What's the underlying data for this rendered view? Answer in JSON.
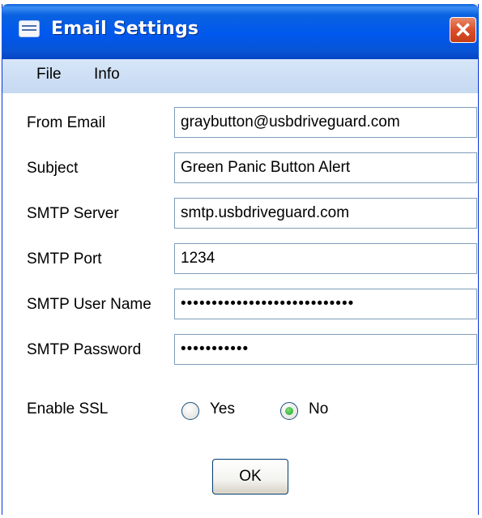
{
  "window": {
    "title": "Email Settings"
  },
  "menu": {
    "items": [
      "File",
      "Info"
    ]
  },
  "form": {
    "from_email": {
      "label": "From Email",
      "value": "graybutton@usbdriveguard.com"
    },
    "subject": {
      "label": "Subject",
      "value": "Green Panic Button Alert"
    },
    "smtp_server": {
      "label": "SMTP Server",
      "value": "smtp.usbdriveguard.com"
    },
    "smtp_port": {
      "label": "SMTP Port",
      "value": "1234"
    },
    "smtp_user": {
      "label": "SMTP User Name",
      "value": "••••••••••••••••••••••••••••"
    },
    "smtp_password": {
      "label": "SMTP Password",
      "value": "•••••••••••"
    },
    "ssl": {
      "label": "Enable SSL",
      "options": [
        "Yes",
        "No"
      ],
      "selected": "No"
    },
    "ok_label": "OK"
  },
  "icons": {
    "title": "envelope-icon",
    "close": "close-icon"
  },
  "colors": {
    "titlebar": "#0058ee",
    "close": "#d9502b",
    "menubar": "#c5d9f2",
    "input_border": "#7f9db9"
  }
}
